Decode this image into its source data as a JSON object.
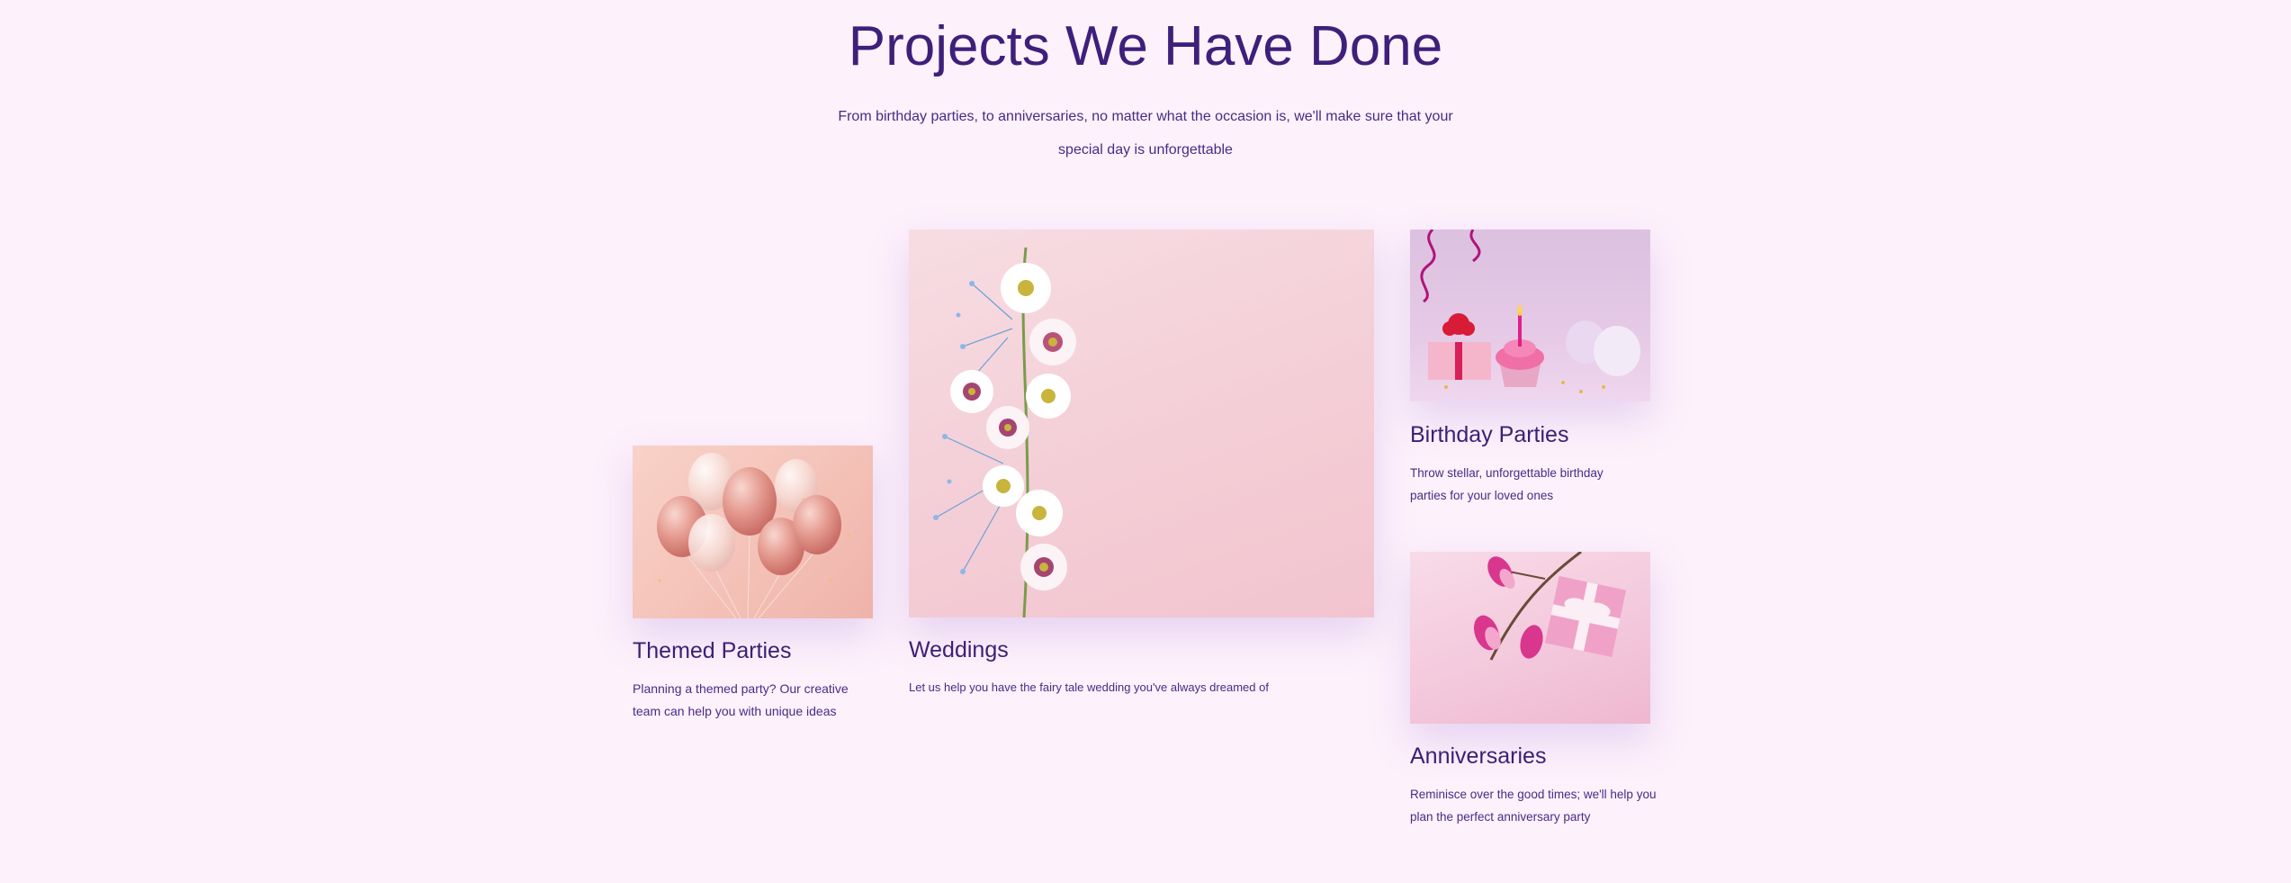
{
  "header": {
    "title": "Projects We Have Done",
    "subtitle": "From birthday parties, to anniversaries, no matter what the occasion is, we'll make sure that your special day is unforgettable"
  },
  "cards": [
    {
      "title": "Themed Parties",
      "text": "Planning a themed party? Our creative team can help you with unique ideas",
      "image": "pink-balloons-image"
    },
    {
      "title": "Weddings",
      "text": "Let us help you have the fairy tale wedding you've always dreamed of",
      "image": "white-daisies-bouquet-image"
    },
    {
      "title": "Birthday Parties",
      "text": "Throw stellar, unforgettable birthday parties for your loved ones",
      "image": "birthday-cupcake-image"
    },
    {
      "title": "Anniversaries",
      "text": "Reminisce over the good times; we'll help you plan the perfect anniversary party",
      "image": "magnolia-gift-box-image"
    }
  ],
  "colors": {
    "background": "#fdf1fb",
    "heading": "#3e1f7a",
    "text": "#4a2a86"
  }
}
